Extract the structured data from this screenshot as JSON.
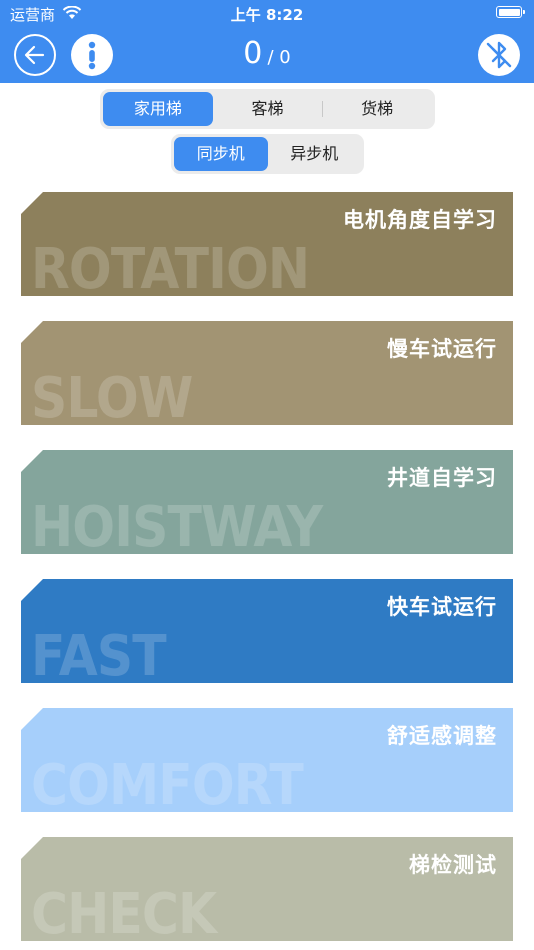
{
  "status": {
    "carrier": "运营商",
    "time": "上午 8:22"
  },
  "header": {
    "count": "0",
    "total": "/ 0",
    "back_icon": "back-arrow-icon",
    "menu_icon": "vertical-dots-icon",
    "bluetooth_icon": "bluetooth-off-icon"
  },
  "elevator_types": [
    "家用梯",
    "客梯",
    "货梯"
  ],
  "motor_types": [
    "同步机",
    "异步机"
  ],
  "cards": [
    {
      "title": "电机角度自学习",
      "bg": "ROTATION",
      "color": "#8d805c"
    },
    {
      "title": "慢车试运行",
      "bg": "SLOW",
      "color": "#a29473"
    },
    {
      "title": "井道自学习",
      "bg": "HOISTWAY",
      "color": "#84a59c"
    },
    {
      "title": "快车试运行",
      "bg": "FAST",
      "color": "#2f7bc4"
    },
    {
      "title": "舒适感调整",
      "bg": "COMFORT",
      "color": "#a6cffb"
    },
    {
      "title": "梯检测试",
      "bg": "CHECK",
      "color": "#b9bca8"
    }
  ],
  "colors": {
    "accent": "#3e8cf0"
  }
}
